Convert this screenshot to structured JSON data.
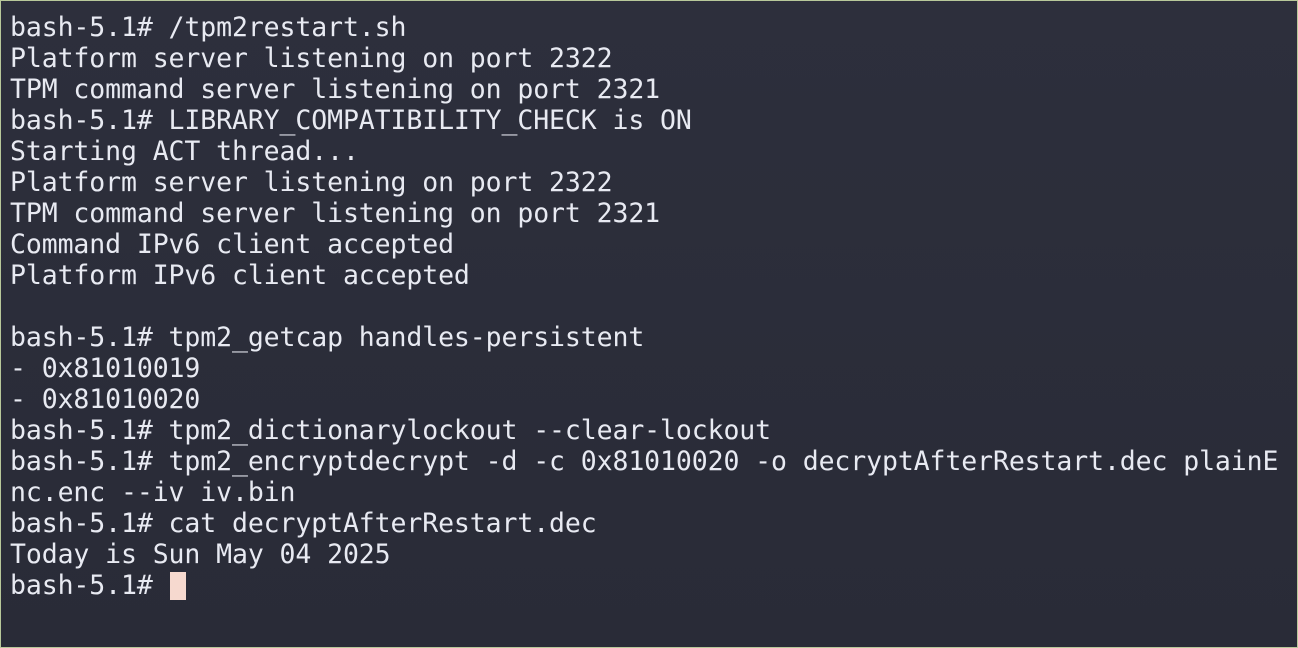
{
  "terminal": {
    "lines": [
      "bash-5.1# /tpm2restart.sh",
      "Platform server listening on port 2322",
      "TPM command server listening on port 2321",
      "bash-5.1# LIBRARY_COMPATIBILITY_CHECK is ON",
      "Starting ACT thread...",
      "Platform server listening on port 2322",
      "TPM command server listening on port 2321",
      "Command IPv6 client accepted",
      "Platform IPv6 client accepted",
      "",
      "bash-5.1# tpm2_getcap handles-persistent",
      "- 0x81010019",
      "- 0x81010020",
      "bash-5.1# tpm2_dictionarylockout --clear-lockout",
      "bash-5.1# tpm2_encryptdecrypt -d -c 0x81010020 -o decryptAfterRestart.dec plainE",
      "nc.enc --iv iv.bin",
      "bash-5.1# cat decryptAfterRestart.dec",
      "Today is Sun May 04 2025"
    ],
    "current_prompt": "bash-5.1# ",
    "cursor_color": "#f6d9cf",
    "text_color": "#e8eaf2",
    "background_color": "#2c2e3a"
  }
}
